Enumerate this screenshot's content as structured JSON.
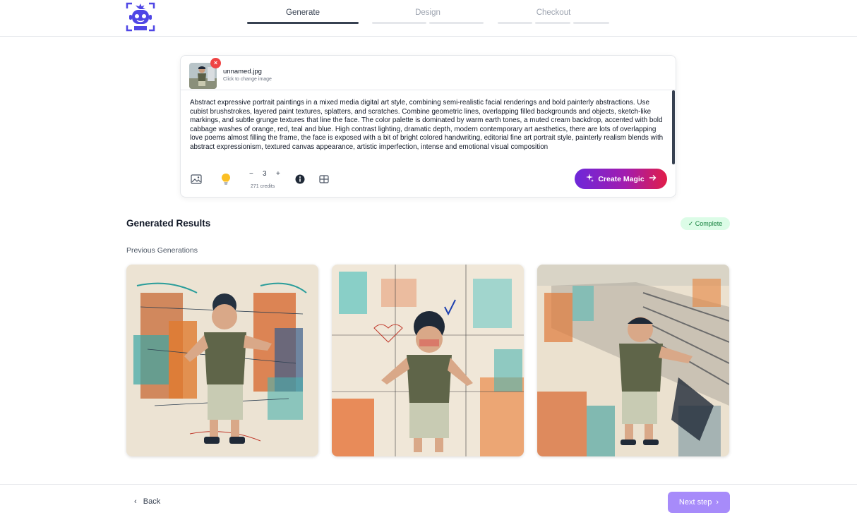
{
  "header": {
    "steps": [
      {
        "label": "Generate",
        "active": true
      },
      {
        "label": "Design",
        "active": false
      },
      {
        "label": "Checkout",
        "active": false
      }
    ]
  },
  "upload": {
    "filename": "unnamed.jpg",
    "hint": "Click to change image",
    "remove_symbol": "×"
  },
  "prompt": {
    "text": "Abstract expressive portrait paintings in a mixed media digital art style, combining semi-realistic facial renderings and bold painterly abstractions. Use cubist brushstrokes, layered paint textures, splatters, and scratches. Combine geometric lines, overlapping filled backgrounds and objects, sketch-like markings, and subtle grunge textures that line the face. The color palette is dominated by warm earth tones, a muted cream backdrop, accented with bold cabbage washes of orange, red, teal and blue. High contrast lighting, dramatic depth, modern contemporary art aesthetics, there are lots of overlapping love poems almost filling the frame, the face is exposed with a bit of bright colored handwriting, editorial fine art portrait style, painterly realism blends with abstract expressionism, textured canvas appearance, artistic imperfection, intense and emotional visual composition"
  },
  "toolbar": {
    "minus": "−",
    "count": "3",
    "plus": "+",
    "credits": "271 credits",
    "cta_label": "Create Magic",
    "icons": [
      "image-icon",
      "lightbulb-icon",
      "info-icon",
      "layout-icon",
      "sparkles-icon",
      "arrow-right-icon"
    ]
  },
  "results": {
    "title": "Generated Results",
    "status": "✓ Complete",
    "previous_label": "Previous Generations"
  },
  "footer": {
    "back_label": "Back",
    "back_chevron": "‹",
    "next_label": "Next step",
    "next_chevron": "›"
  },
  "colors": {
    "accent": "#6d28d9",
    "cta_end": "#e11d48",
    "status_bg": "#dcfce7",
    "status_text": "#15803d",
    "next_button": "#a78bfa"
  }
}
